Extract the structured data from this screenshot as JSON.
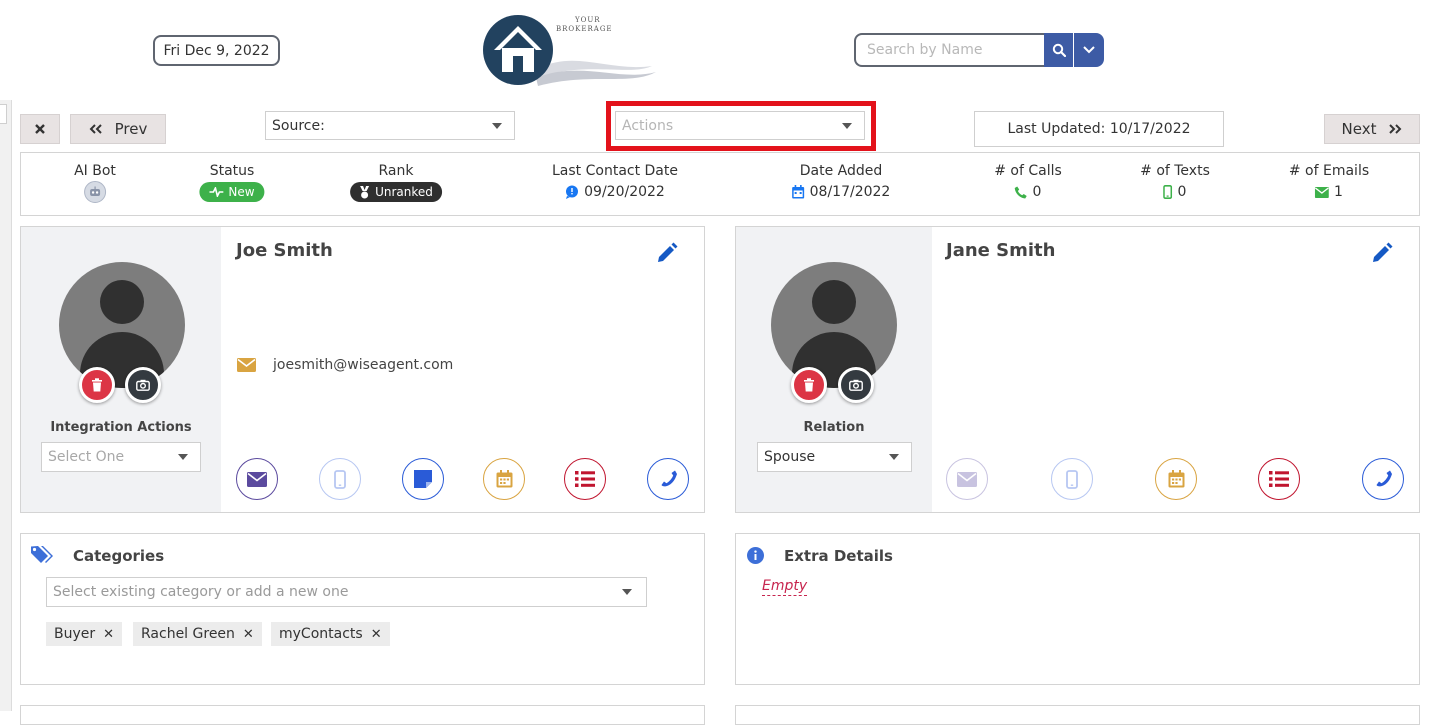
{
  "header": {
    "date": "Fri Dec 9, 2022",
    "logo_text": "YOUR BROKERAGE",
    "search_placeholder": "Search by Name"
  },
  "toolbar": {
    "prev_label": "Prev",
    "next_label": "Next",
    "source_label": "Source:",
    "actions_placeholder": "Actions",
    "last_updated": "Last Updated: 10/17/2022"
  },
  "stats": {
    "ai_bot_label": "AI Bot",
    "status_label": "Status",
    "status_value": "New",
    "rank_label": "Rank",
    "rank_value": "Unranked",
    "last_contact_label": "Last Contact Date",
    "last_contact_value": "09/20/2022",
    "date_added_label": "Date Added",
    "date_added_value": "08/17/2022",
    "calls_label": "# of Calls",
    "calls_value": "0",
    "texts_label": "# of Texts",
    "texts_value": "0",
    "emails_label": "# of Emails",
    "emails_value": "1"
  },
  "contact": {
    "name": "Joe Smith",
    "email": "joesmith@wiseagent.com",
    "integration_label": "Integration Actions",
    "integration_placeholder": "Select One"
  },
  "spouse": {
    "name": "Jane Smith",
    "relation_label": "Relation",
    "relation_value": "Spouse"
  },
  "categories": {
    "title": "Categories",
    "placeholder": "Select existing category or add a new one",
    "tags": [
      "Buyer",
      "Rachel Green",
      "myContacts"
    ]
  },
  "extra": {
    "title": "Extra Details",
    "empty_text": "Empty"
  },
  "colors": {
    "accent": "#3d5ba5",
    "highlight": "#e3121b",
    "status_green": "#3db14a",
    "delete_red": "#dc3545"
  }
}
